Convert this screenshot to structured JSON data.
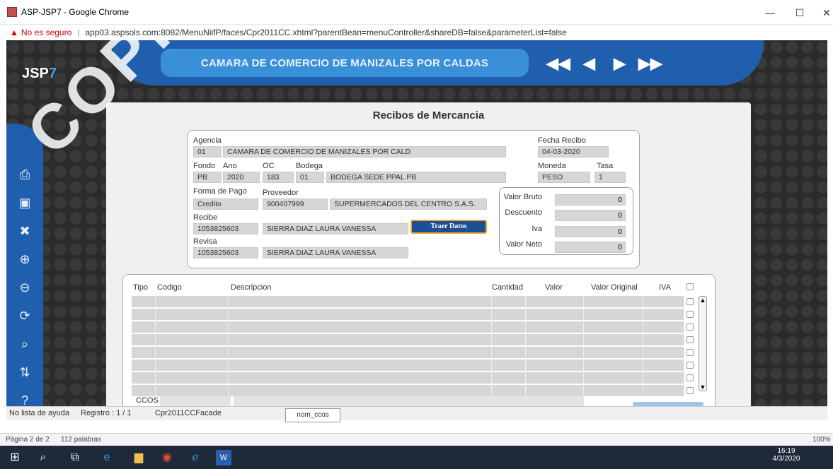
{
  "window": {
    "title": "ASP-JSP7 - Google Chrome",
    "minimize": "—",
    "maximize": "☐",
    "close": "✕"
  },
  "address": {
    "warning": "▲",
    "security": "No es seguro",
    "url": "app03.aspsols.com:8082/MenuNiifP/faces/Cpr2011CC.xhtml?parentBean=menuController&shareDB=false&parameterList=false"
  },
  "app": {
    "logo_a": "JSP",
    "logo_b": "7",
    "header_title": "CAMARA DE COMERCIO DE MANIZALES POR CALDAS",
    "nav": {
      "first": "◀◀",
      "prev": "◀",
      "next": "▶",
      "last": "▶▶"
    }
  },
  "form": {
    "title": "Recibos de Mercancia",
    "agencia_label": "Agencia",
    "agencia_code": "01",
    "agencia_name": "CAMARA DE COMERCIO DE MANIZALES POR CALD",
    "fecha_label": "Fecha Recibo",
    "fecha_value": "04-03-2020",
    "fondo_label": "Fondo",
    "fondo_value": "PB",
    "ano_label": "Ano",
    "ano_value": "2020",
    "oc_label": "OC",
    "oc_value": "183",
    "bodega_label": "Bodega",
    "bodega_code": "01",
    "bodega_name": "BODEGA SEDE PPAL PB",
    "moneda_label": "Moneda",
    "moneda_value": "PESO",
    "tasa_label": "Tasa",
    "tasa_value": "1",
    "forma_pago_label": "Forma de Pago",
    "forma_pago_value": "Credito",
    "proveedor_label": "Proveedor",
    "proveedor_code": "900407999",
    "proveedor_name": "SUPERMERCADOS DEL CENTRO S.A.S.",
    "recibe_label": "Recibe",
    "recibe_code": "1053825603",
    "recibe_name": "SIERRA DIAZ LAURA VANESSA",
    "revisa_label": "Revisa",
    "revisa_code": "1053825603",
    "revisa_name": "SIERRA DIAZ LAURA VANESSA",
    "traer_button": "Traer Datos",
    "valor_bruto_label": "Valor Bruto",
    "valor_bruto": "0",
    "descuento_label": "Descuento",
    "descuento": "0",
    "iva_label": "Iva",
    "iva": "0",
    "valor_neto_label": "Valor Neto",
    "valor_neto": "0"
  },
  "grid": {
    "headers": {
      "tipo": "Tipo",
      "codigo": "Codigo",
      "descripcion": "Descripcion",
      "cantidad": "Cantidad",
      "valor": "Valor",
      "valor_original": "Valor Original",
      "iva": "IVA"
    },
    "ccos_label": "CCOS",
    "scroll_up": "▲",
    "scroll_down": "▼"
  },
  "status": {
    "ayuda": "No lista de ayuda",
    "registro": "Registro : 1 / 1",
    "facade": "Cpr2011CCFacade",
    "tooltip": "nom_ccos"
  },
  "word": {
    "page": "Página 2 de 2",
    "words": "112 palabras",
    "zoom": "100%"
  },
  "taskbar": {
    "time": "16:19",
    "date": "4/3/2020"
  },
  "watermark": "COPIA NO"
}
